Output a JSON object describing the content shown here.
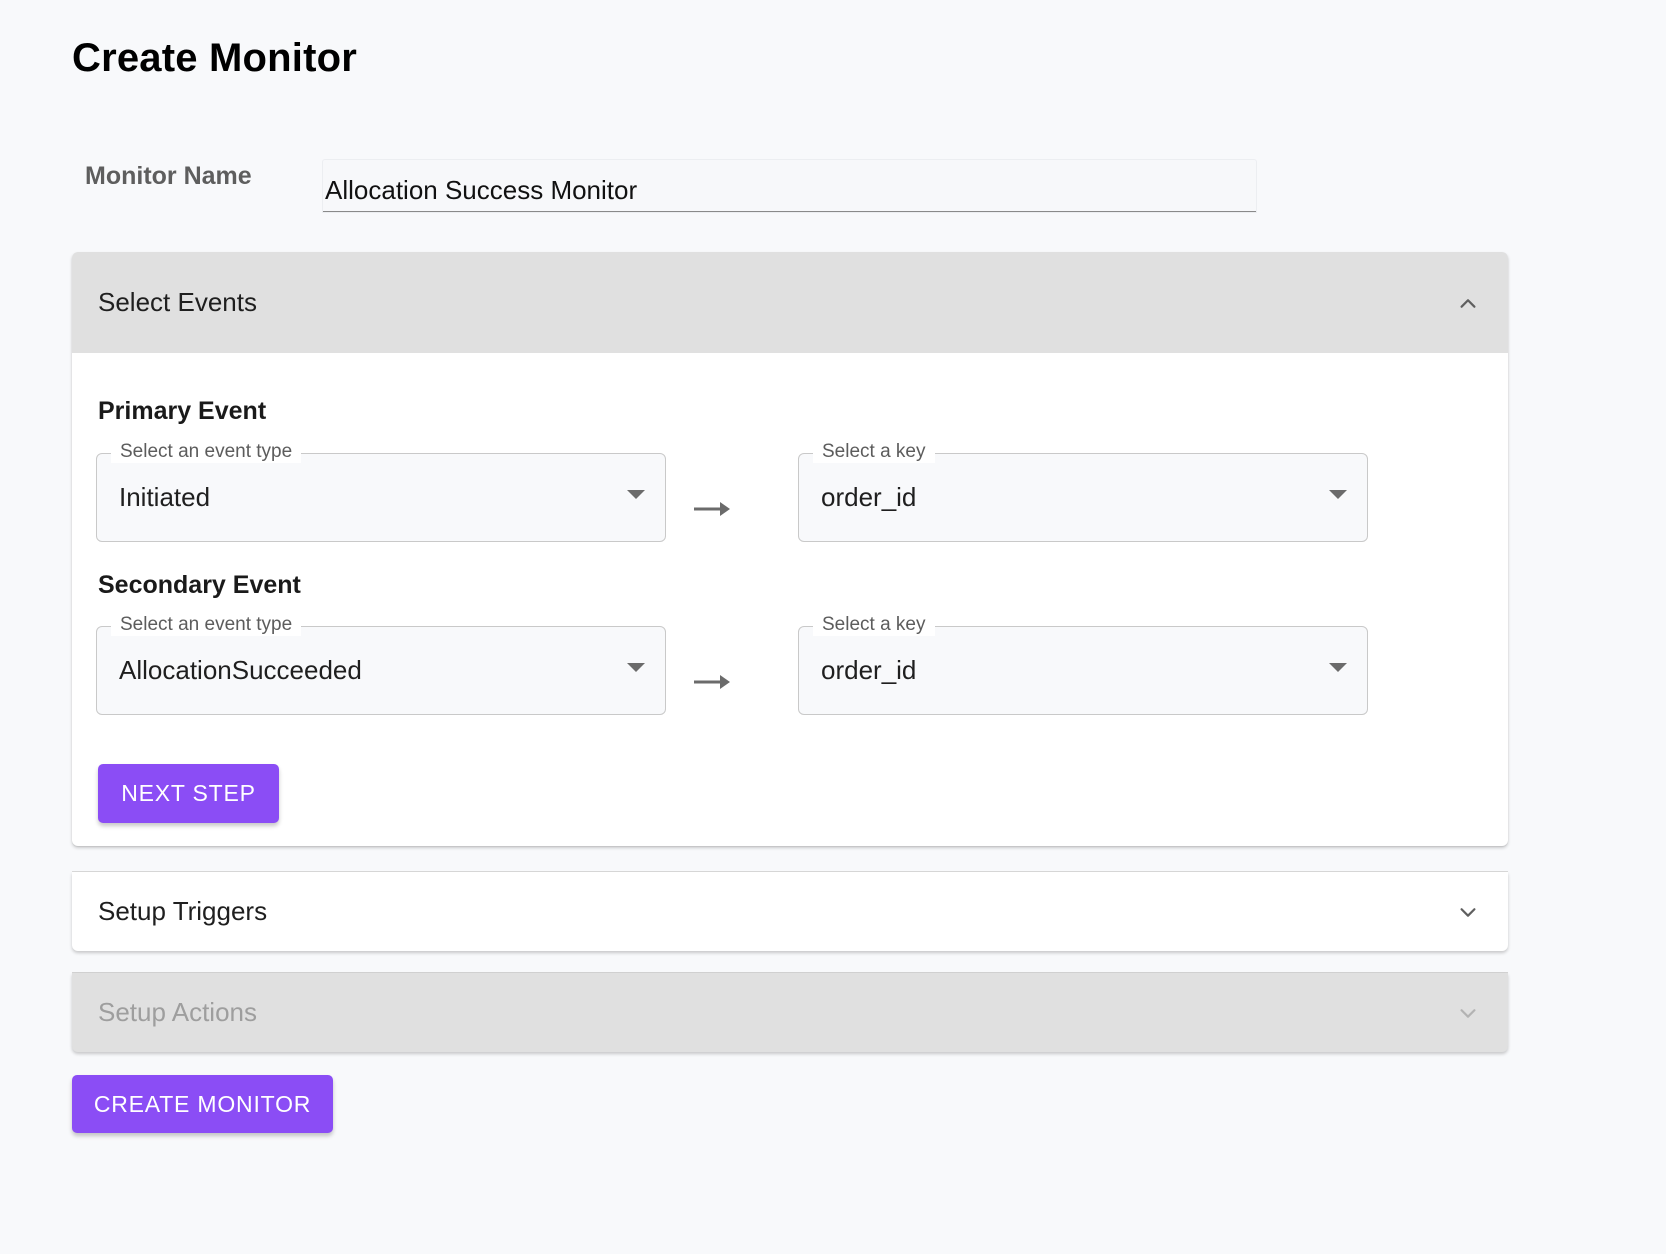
{
  "page": {
    "title": "Create Monitor"
  },
  "monitor_name": {
    "label": "Monitor Name",
    "value": "Allocation Success Monitor"
  },
  "accordions": {
    "select_events": {
      "title": "Select Events",
      "expanded": true,
      "primary": {
        "heading": "Primary Event",
        "event_type_label": "Select an event type",
        "event_type_value": "Initiated",
        "key_label": "Select a key",
        "key_value": "order_id"
      },
      "secondary": {
        "heading": "Secondary Event",
        "event_type_label": "Select an event type",
        "event_type_value": "AllocationSucceeded",
        "key_label": "Select a key",
        "key_value": "order_id"
      },
      "next_step_label": "NEXT STEP"
    },
    "setup_triggers": {
      "title": "Setup Triggers",
      "expanded": false
    },
    "setup_actions": {
      "title": "Setup Actions",
      "expanded": false,
      "disabled": true
    }
  },
  "create_button_label": "CREATE MONITOR",
  "colors": {
    "accent": "#8b4df5",
    "background": "#f8f9fb",
    "accordion_header": "#e0e0e0",
    "disabled_text": "#9e9e9e"
  },
  "icons": {
    "expand_less": "chevron-up-icon",
    "expand_more": "chevron-down-icon",
    "dropdown": "caret-down-icon",
    "mapping": "arrow-right-icon"
  }
}
